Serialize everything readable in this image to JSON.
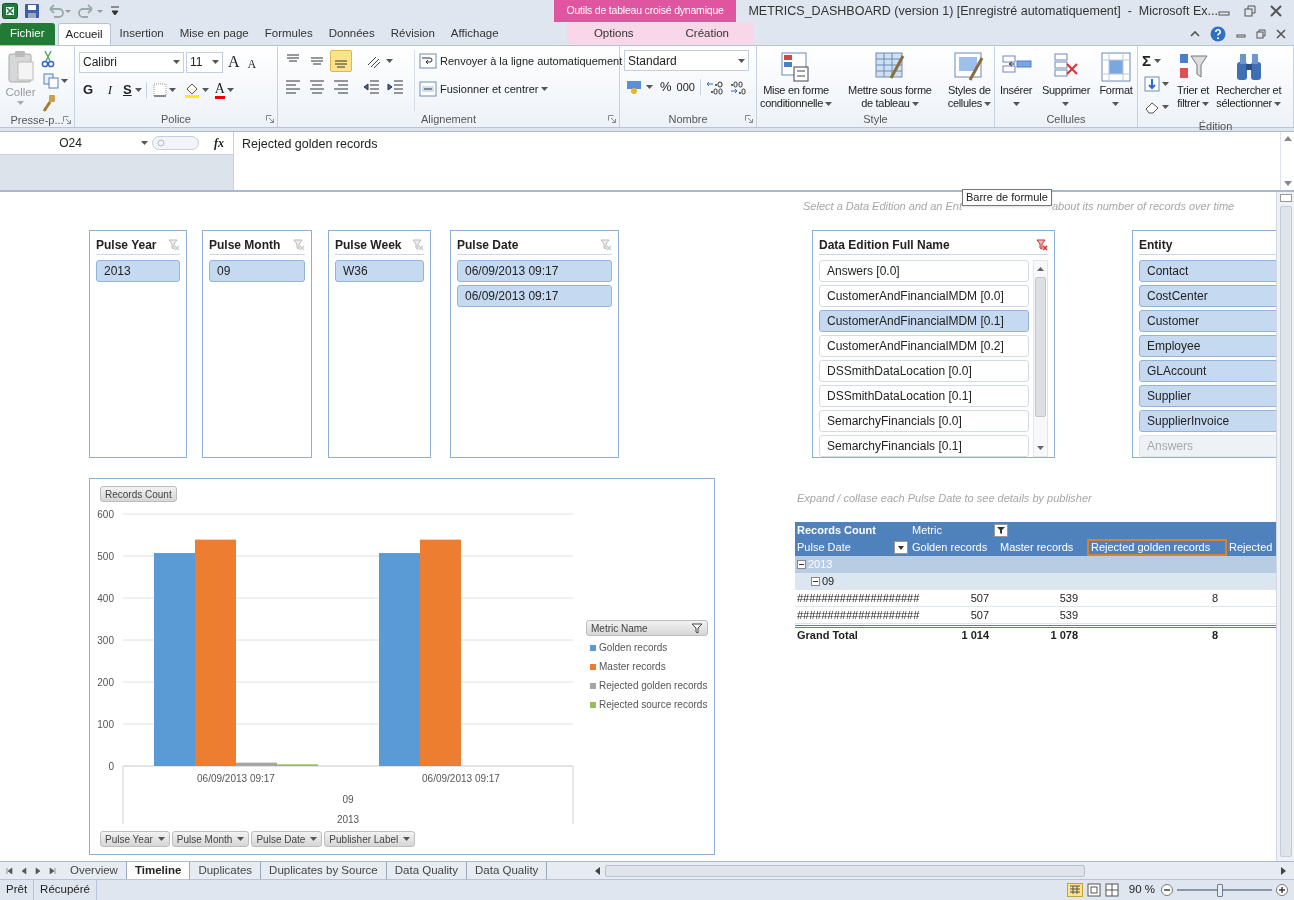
{
  "window": {
    "title": "METRICS_DASHBOARD (version 1) [Enregistré automatiquement]  -  Microsoft Ex...",
    "context_group": "Outils de tableau croisé dynamique"
  },
  "tabs": [
    {
      "label": "Fichier",
      "kind": "file",
      "selected": false
    },
    {
      "label": "Accueil",
      "kind": "normal",
      "selected": true
    },
    {
      "label": "Insertion",
      "kind": "normal",
      "selected": false
    },
    {
      "label": "Mise en page",
      "kind": "normal",
      "selected": false
    },
    {
      "label": "Formules",
      "kind": "normal",
      "selected": false
    },
    {
      "label": "Données",
      "kind": "normal",
      "selected": false
    },
    {
      "label": "Révision",
      "kind": "normal",
      "selected": false
    },
    {
      "label": "Affichage",
      "kind": "normal",
      "selected": false
    },
    {
      "label": "Options",
      "kind": "contextual",
      "selected": false
    },
    {
      "label": "Création",
      "kind": "contextual",
      "selected": false
    }
  ],
  "ribbon": {
    "clipboard": {
      "label": "Presse-p...",
      "paste": "Coller",
      "paste_disabled": true
    },
    "font": {
      "label": "Police",
      "font_name": "Calibri",
      "font_size": "11",
      "grow": "A",
      "shrink": "A",
      "bold": "G",
      "italic": "I",
      "underline": "S",
      "font_color": "A"
    },
    "alignment": {
      "label": "Alignement",
      "vertical": [
        {
          "selected": false
        },
        {
          "selected": false
        },
        {
          "selected": true
        }
      ],
      "wrap": "Renvoyer à la ligne automatiquement",
      "merge": "Fusionner et centrer"
    },
    "number": {
      "label": "Nombre",
      "format": "Standard",
      "percent": "%",
      "thousands": "000"
    },
    "style": {
      "label": "Style",
      "buttons": [
        {
          "lines": [
            "Mise en forme",
            "conditionnelle"
          ]
        },
        {
          "lines": [
            "Mettre sous forme",
            "de tableau"
          ]
        },
        {
          "lines": [
            "Styles de",
            "cellules"
          ]
        }
      ]
    },
    "cells": {
      "label": "Cellules",
      "buttons": [
        "Insérer",
        "Supprimer",
        "Format"
      ]
    },
    "editing": {
      "label": "Édition",
      "sum": "Σ",
      "buttons": [
        {
          "lines": [
            "Trier et",
            "filtrer"
          ]
        },
        {
          "lines": [
            "Rechercher et",
            "sélectionner"
          ]
        }
      ]
    }
  },
  "formula_bar": {
    "name_box": "O24",
    "fx": "fx",
    "content": "Rejected golden records",
    "tooltip": "Barre de formule"
  },
  "sheet": {
    "hint_top": [
      "Select a Data Edition and an Ent",
      "about its number of records over time"
    ],
    "hint_pivot": "Expand / collase each Pulse Date to see details by publisher",
    "slicers": [
      {
        "title": "Pulse Year",
        "clear_filter_enabled": false,
        "scrollable": false,
        "items": [
          {
            "label": "2013",
            "selected": true,
            "has_data": true
          }
        ]
      },
      {
        "title": "Pulse Month",
        "clear_filter_enabled": false,
        "scrollable": false,
        "items": [
          {
            "label": "09",
            "selected": true,
            "has_data": true
          }
        ]
      },
      {
        "title": "Pulse Week",
        "clear_filter_enabled": false,
        "scrollable": false,
        "items": [
          {
            "label": "W36",
            "selected": true,
            "has_data": true
          }
        ]
      },
      {
        "title": "Pulse Date",
        "clear_filter_enabled": false,
        "scrollable": false,
        "items": [
          {
            "label": "06/09/2013 09:17",
            "selected": true,
            "has_data": true
          },
          {
            "label": "06/09/2013 09:17",
            "selected": true,
            "has_data": true
          }
        ]
      },
      {
        "title": "Data Edition Full Name",
        "clear_filter_enabled": true,
        "scrollable": true,
        "items": [
          {
            "label": "Answers [0.0]",
            "selected": false,
            "has_data": true
          },
          {
            "label": "CustomerAndFinancialMDM [0.0]",
            "selected": false,
            "has_data": true
          },
          {
            "label": "CustomerAndFinancialMDM [0.1]",
            "selected": true,
            "has_data": true
          },
          {
            "label": "CustomerAndFinancialMDM [0.2]",
            "selected": false,
            "has_data": true
          },
          {
            "label": "DSSmithDataLocation [0.0]",
            "selected": false,
            "has_data": true
          },
          {
            "label": "DSSmithDataLocation [0.1]",
            "selected": false,
            "has_data": true
          },
          {
            "label": "SemarchyFinancials [0.0]",
            "selected": false,
            "has_data": true
          },
          {
            "label": "SemarchyFinancials [0.1]",
            "selected": false,
            "has_data": true
          }
        ]
      },
      {
        "title": "Entity",
        "scrollable": false,
        "items": [
          {
            "label": "Contact",
            "selected": true,
            "has_data": true
          },
          {
            "label": "CostCenter",
            "selected": true,
            "has_data": true
          },
          {
            "label": "Customer",
            "selected": true,
            "has_data": true
          },
          {
            "label": "Employee",
            "selected": true,
            "has_data": true
          },
          {
            "label": "GLAccount",
            "selected": true,
            "has_data": true
          },
          {
            "label": "Supplier",
            "selected": true,
            "has_data": true
          },
          {
            "label": "SupplierInvoice",
            "selected": true,
            "has_data": true
          },
          {
            "label": "Answers",
            "selected": false,
            "has_data": false
          }
        ]
      }
    ],
    "chart": {
      "value_button": "Records Count",
      "axis_buttons": [
        "Pulse Year",
        "Pulse Month",
        "Pulse Date",
        "Publisher Label"
      ],
      "legend_title": "Metric Name",
      "group_labels": [
        "09",
        "2013"
      ],
      "chart_data": {
        "type": "bar",
        "grid": true,
        "legend": true,
        "categories": [
          "06/09/2013 09:17",
          "06/09/2013 09:17"
        ],
        "ylim": [
          0,
          600
        ],
        "yticks": [
          0,
          100,
          200,
          300,
          400,
          500,
          600
        ],
        "series": [
          {
            "name": "Golden records",
            "color": "#5b9bd5",
            "values": [
              507,
              507
            ]
          },
          {
            "name": "Master records",
            "color": "#ed7d31",
            "values": [
              539,
              539
            ]
          },
          {
            "name": "Rejected golden records",
            "color": "#a5a5a5",
            "values": [
              8,
              null
            ]
          },
          {
            "name": "Rejected source records",
            "color": "#9bbb59",
            "values": [
              4,
              null
            ]
          }
        ]
      }
    },
    "pivot": {
      "value_label": "Records Count",
      "column_field": "Metric",
      "row_field": "Pulse Date",
      "columns": [
        {
          "label": "Golden records",
          "selected": false
        },
        {
          "label": "Master records",
          "selected": false
        },
        {
          "label": "Rejected golden records",
          "selected": true
        },
        {
          "label": "Rejected",
          "selected": false
        }
      ],
      "rows": [
        {
          "kind": "year",
          "label": "2013",
          "expanded": true,
          "cells": []
        },
        {
          "kind": "month",
          "label": "09",
          "expanded": true,
          "cells": []
        },
        {
          "kind": "data",
          "label": "####################",
          "cells": [
            "507",
            "539",
            "8"
          ]
        },
        {
          "kind": "data",
          "label": "####################",
          "cells": [
            "507",
            "539"
          ]
        },
        {
          "kind": "total",
          "label": "Grand Total",
          "cells": [
            "1 014",
            "1 078",
            "8"
          ]
        }
      ]
    }
  },
  "sheet_tabs": [
    {
      "label": "Overview",
      "selected": false
    },
    {
      "label": "Timeline",
      "selected": true
    },
    {
      "label": "Duplicates",
      "selected": false
    },
    {
      "label": "Duplicates by Source",
      "selected": false
    },
    {
      "label": "Data Quality",
      "selected": false
    },
    {
      "label": "Data Quality",
      "selected": false
    }
  ],
  "status_bar": {
    "items": [
      "Prêt",
      "Récupéré"
    ],
    "zoom": "90 %",
    "zoom_slider": {
      "level": 0.45
    }
  }
}
